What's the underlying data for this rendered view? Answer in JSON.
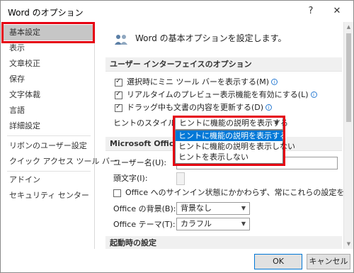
{
  "window": {
    "title": "Word のオプション",
    "help_icon": "?",
    "close_icon": "✕"
  },
  "sidebar": {
    "items": [
      {
        "label": "基本設定",
        "selected": true
      },
      {
        "label": "表示"
      },
      {
        "label": "文章校正"
      },
      {
        "label": "保存"
      },
      {
        "label": "文字体裁"
      },
      {
        "label": "言語"
      },
      {
        "label": "詳細設定"
      },
      {
        "label": "リボンのユーザー設定"
      },
      {
        "label": "クイック アクセス ツール バー"
      },
      {
        "label": "アドイン"
      },
      {
        "label": "セキュリティ センター"
      }
    ]
  },
  "main": {
    "header": "Word の基本オプションを設定します。",
    "ui_section": {
      "title": "ユーザー インターフェイスのオプション",
      "options": [
        {
          "label": "選択時にミニ ツール バーを表示する(M)",
          "checked": true
        },
        {
          "label": "リアルタイムのプレビュー表示機能を有効にする(L)",
          "checked": true
        },
        {
          "label": "ドラッグ中も文書の内容を更新する(D)",
          "checked": true
        }
      ],
      "tooltip_style_label": "ヒントのスタイル(R):",
      "tooltip_style_value": "ヒントに機能の説明を表示する",
      "tooltip_style_options": [
        "ヒントに機能の説明を表示する",
        "ヒントに機能の説明を表示しない",
        "ヒントを表示しない"
      ]
    },
    "office_section": {
      "title": "Microsoft Office",
      "username_label": "ユーザー名(U):",
      "initials_label": "頭文字(I):",
      "signin_option": "Office へのサインイン状態にかかわらず、常にこれらの設定を使用する(A)",
      "background_label": "Office の背景(B):",
      "background_value": "背景なし",
      "theme_label": "Office テーマ(T):",
      "theme_value": "カラフル"
    },
    "startup_section": {
      "title": "起動時の設定"
    }
  },
  "footer": {
    "ok": "OK",
    "cancel": "キャンセル"
  },
  "colors": {
    "highlight": "#e60012",
    "selection": "#0078d7"
  }
}
